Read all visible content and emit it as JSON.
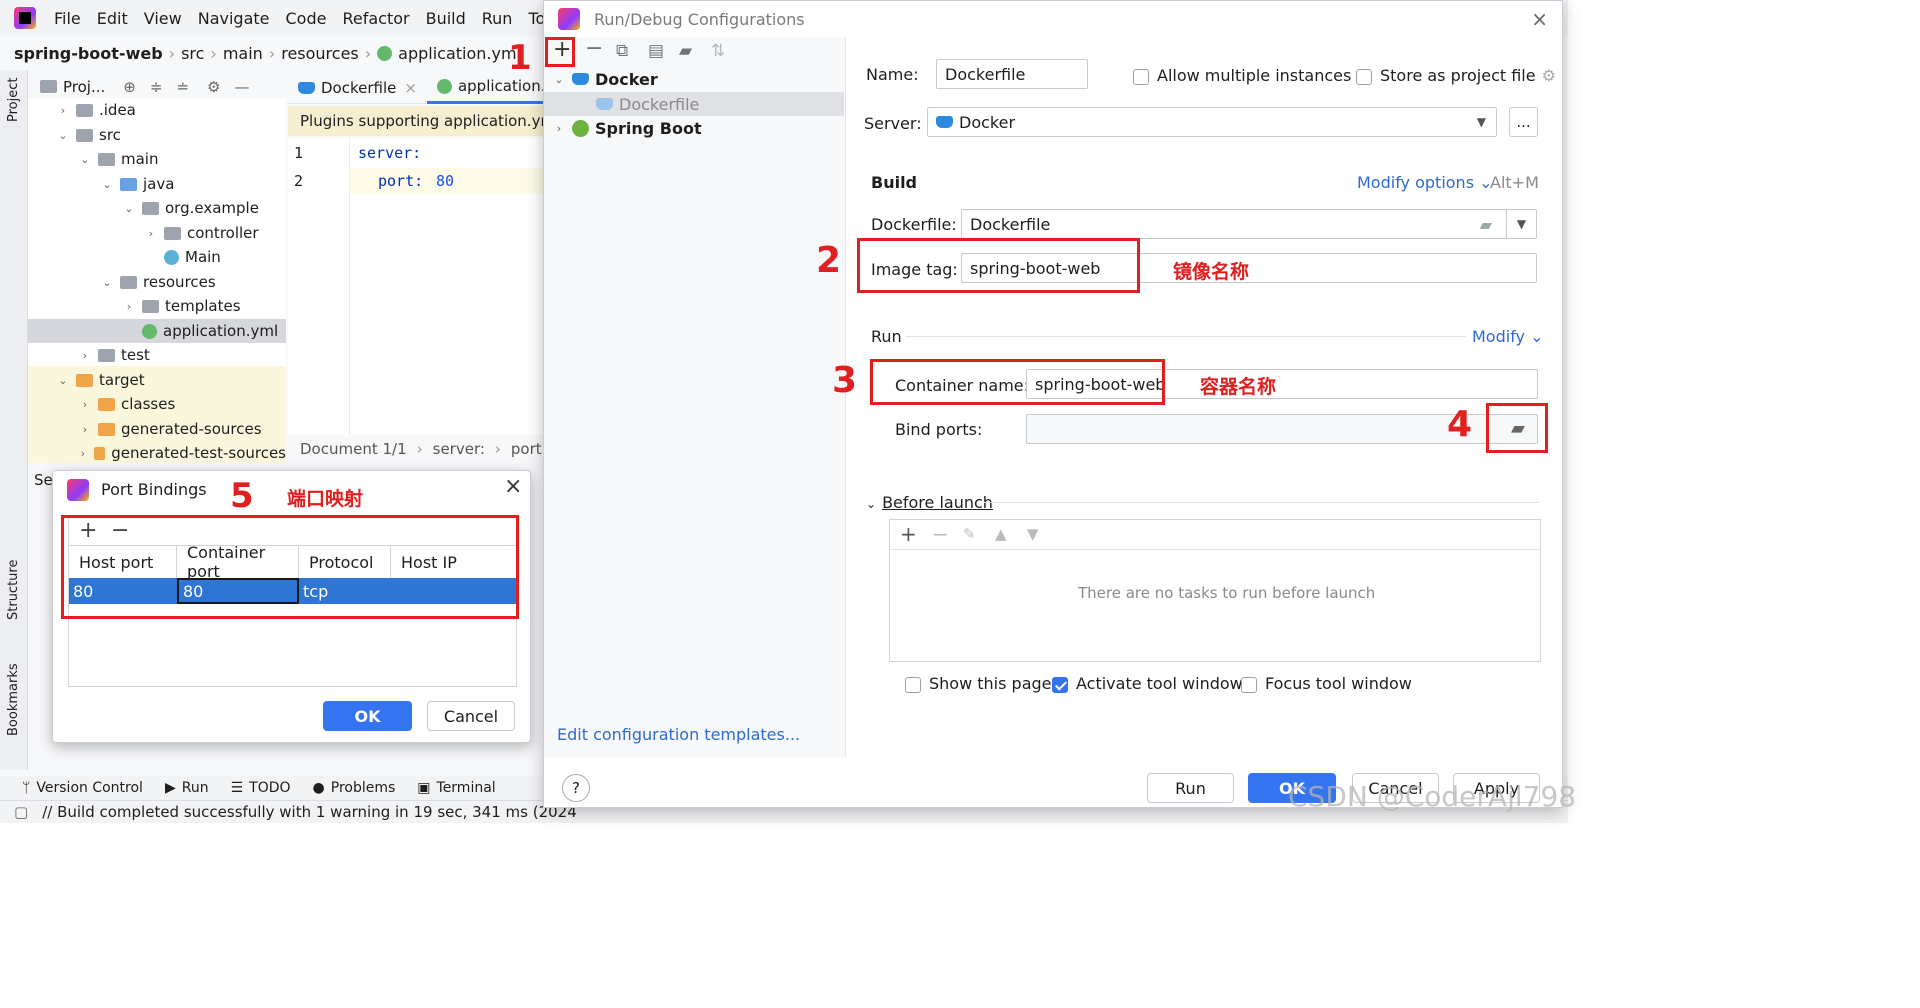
{
  "menu": [
    "File",
    "Edit",
    "View",
    "Navigate",
    "Code",
    "Refactor",
    "Build",
    "Run",
    "Tools"
  ],
  "breadcrumb": [
    "spring-boot-web",
    "src",
    "main",
    "resources",
    "application.yml"
  ],
  "side_strip": {
    "project": "Project",
    "structure": "Structure",
    "bookmarks": "Bookmarks"
  },
  "project_panel": {
    "title": "Proj..."
  },
  "tree": [
    {
      "label": ".idea",
      "icon": "folder-icon"
    },
    {
      "label": "src",
      "icon": "folder-icon"
    },
    {
      "label": "main",
      "icon": "folder-icon"
    },
    {
      "label": "java",
      "icon": "folder-blue-icon"
    },
    {
      "label": "org.example",
      "icon": "package-icon"
    },
    {
      "label": "controller",
      "icon": "package-icon"
    },
    {
      "label": "Main",
      "icon": "class-icon"
    },
    {
      "label": "resources",
      "icon": "folder-icon"
    },
    {
      "label": "templates",
      "icon": "folder-icon"
    },
    {
      "label": "application.yml",
      "icon": "spring-file-icon"
    },
    {
      "label": "test",
      "icon": "folder-icon"
    },
    {
      "label": "target",
      "icon": "folder-orange-icon"
    },
    {
      "label": "classes",
      "icon": "folder-orange-icon"
    },
    {
      "label": "generated-sources",
      "icon": "folder-orange-icon"
    },
    {
      "label": "generated-test-sources",
      "icon": "folder-orange-icon"
    }
  ],
  "editor": {
    "tabs": [
      "Dockerfile",
      "application.y"
    ],
    "banner": "Plugins supporting application.ym",
    "lines": [
      {
        "num": "1",
        "key": "server:",
        "val": ""
      },
      {
        "num": "2",
        "key": "port:",
        "val": "80"
      }
    ],
    "status": {
      "doc": "Document 1/1",
      "path1": "server:",
      "path2": "port:"
    },
    "partial_label": "Se"
  },
  "bottom_tools": [
    "Version Control",
    "Run",
    "TODO",
    "Problems",
    "Terminal"
  ],
  "status_message": "// Build completed successfully with 1 warning in 19 sec, 341 ms (2024",
  "run_debug": {
    "title": "Run/Debug Configurations",
    "tree": [
      {
        "label": "Docker",
        "bold": true
      },
      {
        "label": "Dockerfile",
        "bold": false
      },
      {
        "label": "Spring Boot",
        "bold": true
      }
    ],
    "edit_templates": "Edit configuration templates...",
    "name_label": "Name:",
    "name_value": "Dockerfile",
    "allow_multiple": "Allow multiple instances",
    "store_as_file": "Store as project file",
    "server_label": "Server:",
    "server_value": "Docker",
    "server_more": "...",
    "build_label": "Build",
    "modify_options": "Modify options",
    "modify_shortcut": "Alt+M",
    "dockerfile_label": "Dockerfile:",
    "dockerfile_value": "Dockerfile",
    "image_tag_label": "Image tag:",
    "image_tag_value": "spring-boot-web",
    "run_label": "Run",
    "modify": "Modify",
    "container_name_label": "Container name:",
    "container_name_value": "spring-boot-web",
    "bind_ports_label": "Bind ports:",
    "before_launch": "Before launch",
    "no_tasks": "There are no tasks to run before launch",
    "show_page": "Show this page",
    "activate_tool": "Activate tool window",
    "focus_tool": "Focus tool window",
    "buttons": {
      "run": "Run",
      "ok": "OK",
      "cancel": "Cancel",
      "apply": "Apply"
    },
    "help": "?"
  },
  "annotations": {
    "n1": "1",
    "n2": "2",
    "n3": "3",
    "n4": "4",
    "n5": "5",
    "image_name": "镜像名称",
    "container_name": "容器名称",
    "port_mapping": "端口映射"
  },
  "port_bindings": {
    "title": "Port Bindings",
    "columns": [
      "Host port",
      "Container port",
      "Protocol",
      "Host IP"
    ],
    "row": [
      "80",
      "80",
      "tcp",
      ""
    ],
    "ok": "OK",
    "cancel": "Cancel"
  },
  "watermark": "CSDN @CoderAjl798",
  "colors": {
    "accent": "#3574f0",
    "annotation_red": "#e02020",
    "selection": "#2f75d4"
  }
}
